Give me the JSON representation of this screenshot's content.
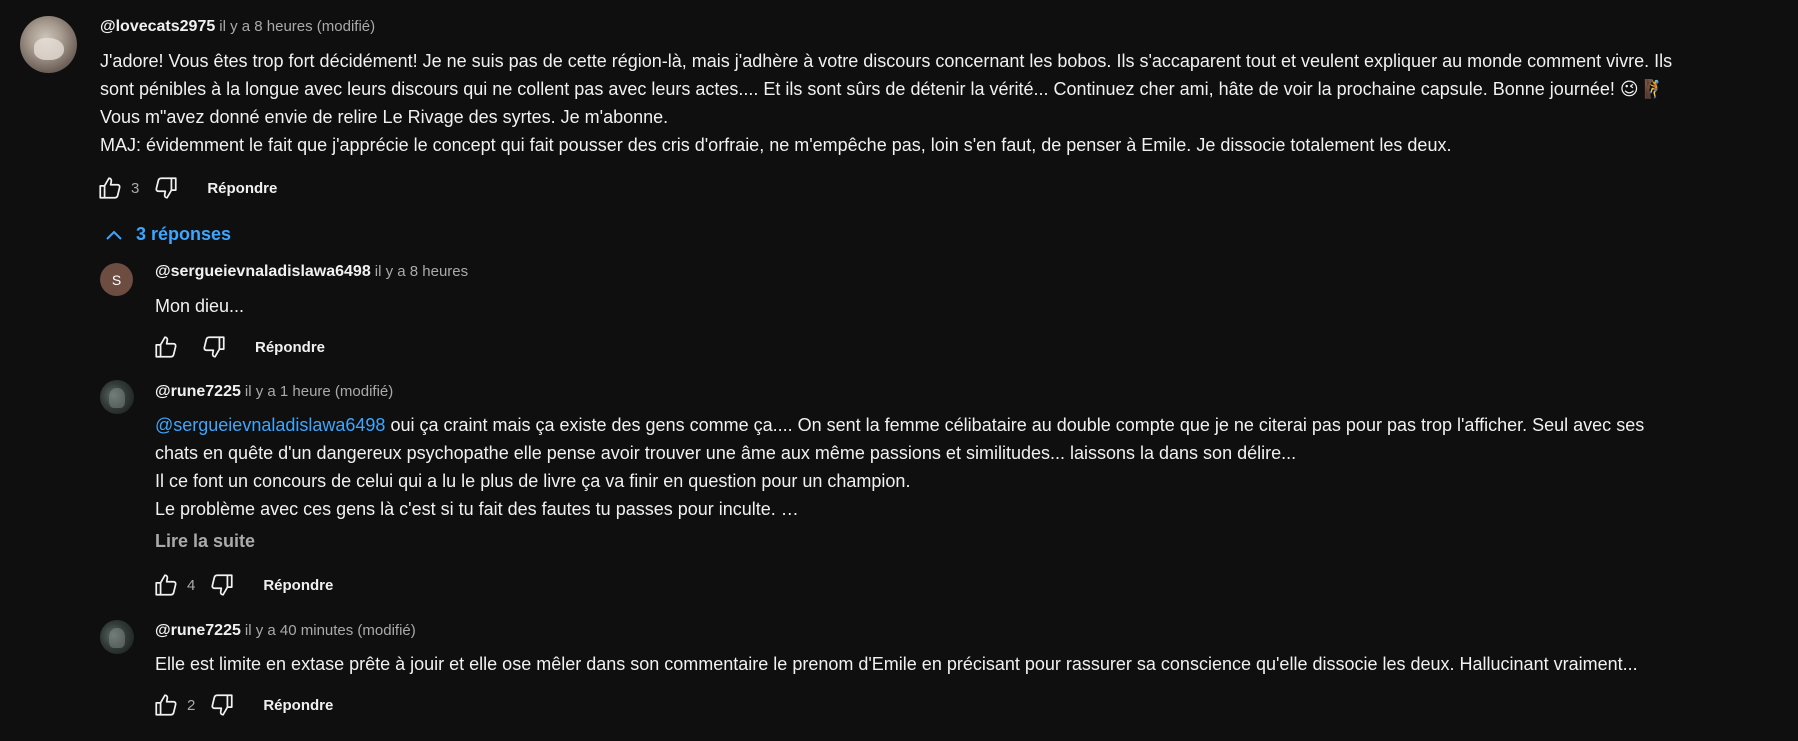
{
  "main_comment": {
    "author": "@lovecats2975",
    "meta": "il y a 8 heures (modifié)",
    "lines": [
      "J'adore! Vous êtes trop fort décidément! Je ne suis pas de cette région-là, mais j'adhère à votre discours concernant les bobos. Ils s'accaparent tout et veulent expliquer au monde comment vivre. Ils",
      "sont pénibles à la longue avec leurs discours qui ne collent pas avec leurs actes.... Et ils sont sûrs de détenir la vérité... Continuez cher ami, hâte de voir la prochaine capsule. Bonne journée! 😉 🧗",
      "Vous m\"avez donné envie de relire Le Rivage des syrtes. Je m'abonne.",
      "MAJ: évidemment le fait que j'apprécie le concept qui fait pousser des cris d'orfraie, ne m'empêche pas, loin s'en faut, de penser à Emile. Je dissocie totalement les deux."
    ],
    "likes": "3",
    "reply_label": "Répondre"
  },
  "replies_toggle": {
    "label": "3 réponses",
    "icon": "chevron-up-icon"
  },
  "replies": [
    {
      "author": "@sergueievnaladislawa6498",
      "meta": "il y a 8 heures",
      "avatar_letter": "S",
      "avatar_color": "#6d4c41",
      "lines": [
        "Mon dieu..."
      ],
      "likes": "",
      "reply_label": "Répondre"
    },
    {
      "author": "@rune7225",
      "meta": "il y a 1 heure (modifié)",
      "mention": "@sergueievnaladislawa6498",
      "first_line_rest": " oui ça craint mais ça existe des gens comme ça.... On sent la femme célibataire au double compte que je ne citerai pas pour pas trop l'afficher. Seul avec ses",
      "lines": [
        "chats en quête d'un dangereux psychopathe elle pense avoir trouver une âme aux même passions et similitudes... laissons la dans son délire...",
        "Il ce font un concours de celui qui a lu le plus de livre ça va finir en question pour un champion.",
        "Le problème avec ces gens là c'est si tu fait des fautes tu passes pour inculte. …"
      ],
      "read_more": "Lire la suite",
      "likes": "4",
      "reply_label": "Répondre"
    },
    {
      "author": "@rune7225",
      "meta": "il y a 40 minutes (modifié)",
      "lines": [
        "Elle est limite en extase prête à jouir et elle ose mêler dans son commentaire le prenom d'Emile en précisant pour rassurer sa conscience qu'elle dissocie les deux. Hallucinant vraiment..."
      ],
      "likes": "2",
      "reply_label": "Répondre"
    }
  ],
  "colors": {
    "background": "#0f0f0f",
    "text": "#f1f1f1",
    "secondary_text": "#aaaaaa",
    "link": "#3ea6ff"
  }
}
